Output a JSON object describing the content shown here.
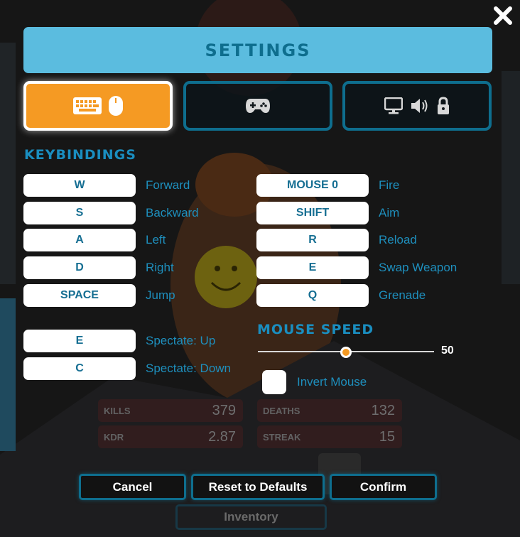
{
  "title": "SETTINGS",
  "tabs": [
    {
      "name": "keyboard-mouse",
      "icons": [
        "keyboard-icon",
        "mouse-icon"
      ],
      "active": true
    },
    {
      "name": "gamepad",
      "icons": [
        "gamepad-icon"
      ],
      "active": false
    },
    {
      "name": "display-audio-privacy",
      "icons": [
        "monitor-icon",
        "speaker-icon",
        "lock-icon"
      ],
      "active": false
    }
  ],
  "keybindings_title": "KEYBINDINGS",
  "left_bindings": [
    {
      "key": "W",
      "action": "Forward"
    },
    {
      "key": "S",
      "action": "Backward"
    },
    {
      "key": "A",
      "action": "Left"
    },
    {
      "key": "D",
      "action": "Right"
    },
    {
      "key": "SPACE",
      "action": "Jump"
    }
  ],
  "spectate_bindings": [
    {
      "key": "E",
      "action": "Spectate: Up"
    },
    {
      "key": "C",
      "action": "Spectate: Down"
    }
  ],
  "right_bindings": [
    {
      "key": "MOUSE 0",
      "action": "Fire"
    },
    {
      "key": "SHIFT",
      "action": "Aim"
    },
    {
      "key": "R",
      "action": "Reload"
    },
    {
      "key": "E",
      "action": "Swap Weapon"
    },
    {
      "key": "Q",
      "action": "Grenade"
    }
  ],
  "mouse_speed": {
    "title": "MOUSE SPEED",
    "value": 50,
    "fraction": 0.5
  },
  "invert_mouse": {
    "label": "Invert Mouse",
    "checked": false
  },
  "stats": [
    {
      "label": "KILLS",
      "value": "379"
    },
    {
      "label": "DEATHS",
      "value": "132"
    },
    {
      "label": "KDR",
      "value": "2.87"
    },
    {
      "label": "STREAK",
      "value": "15"
    }
  ],
  "buttons": {
    "cancel": "Cancel",
    "reset": "Reset to Defaults",
    "confirm": "Confirm"
  },
  "inventory": "Inventory",
  "colors": {
    "accent": "#5bbcdf",
    "title_text": "#0e6e8e",
    "active_tab": "#f59a23",
    "border": "#0e6e8e",
    "label": "#1e8fbd",
    "key_text": "#156e92"
  }
}
